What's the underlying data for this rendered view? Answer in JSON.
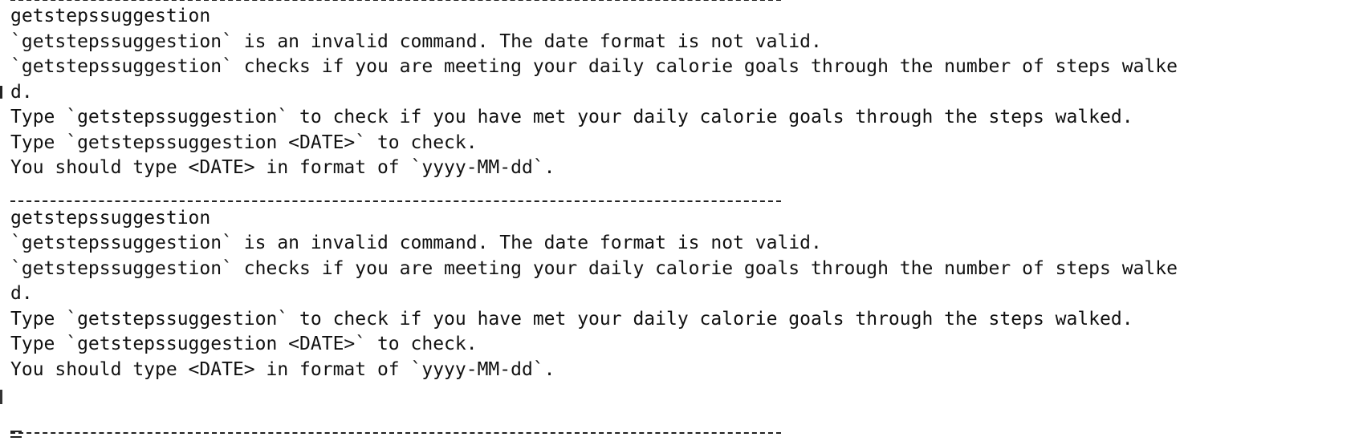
{
  "blocks": [
    {
      "command": "getstepssuggestion",
      "error": "`getstepssuggestion` is an invalid command. The date format is not valid.",
      "description_part1": "`getstepssuggestion` checks if you are meeting your daily calorie goals through the number of steps walke",
      "description_part2": "d.",
      "usage_1": "Type `getstepssuggestion` to check if you have met your daily calorie goals through the steps walked.",
      "usage_2": "Type `getstepssuggestion <DATE>` to check.",
      "usage_3": "You should type <DATE> in format of `yyyy-MM-dd`."
    },
    {
      "command": "getstepssuggestion",
      "error": "`getstepssuggestion` is an invalid command. The date format is not valid.",
      "description_part1": "`getstepssuggestion` checks if you are meeting your daily calorie goals through the number of steps walke",
      "description_part2": "d.",
      "usage_1": "Type `getstepssuggestion` to check if you have met your daily calorie goals through the steps walked.",
      "usage_2": "Type `getstepssuggestion <DATE>` to check.",
      "usage_3": "You should type <DATE> in format of `yyyy-MM-dd`."
    }
  ]
}
